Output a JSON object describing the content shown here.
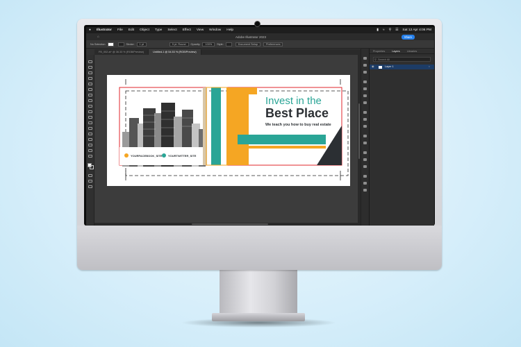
{
  "menubar": {
    "apple_icon": "apple-icon",
    "items": [
      "Illustrator",
      "File",
      "Edit",
      "Object",
      "Type",
      "Select",
      "Effect",
      "View",
      "Window",
      "Help"
    ],
    "clock": "Sat 12 Apr  4:06 PM"
  },
  "titlebar": {
    "title": "Adobe Illustrator 2023",
    "share_label": "Share"
  },
  "control_bar": {
    "selection": "No Selection",
    "stroke_label": "Stroke:",
    "stroke_value": "1 pt",
    "brush": "5 pt. Round",
    "opacity_label": "Opacity:",
    "opacity_value": "100%",
    "style_label": "Style:",
    "document_setup": "Document Setup",
    "preferences": "Preferences"
  },
  "tabs": [
    {
      "label": "FB_002.ai* @ 36.33 % (RGB/Preview)",
      "active": false
    },
    {
      "label": "Untitled-1 @ 54.53 % (RGB/Preview)",
      "active": true
    }
  ],
  "panel": {
    "tabs": [
      "Properties",
      "Layers",
      "Libraries"
    ],
    "active_tab": "Layers",
    "search_placeholder": "Search All",
    "layers": [
      "Layer 1"
    ]
  },
  "artwork": {
    "headline_line1": "Invest in the",
    "headline_line2": "Best Place",
    "subline": "We teach you how to buy real estate",
    "facebook": "YOURFACEBOOK_SITE",
    "twitter": "YOURTWITTER_SITE",
    "colors": {
      "teal": "#2aa596",
      "orange": "#f5a623",
      "dark": "#2b2f33",
      "red_bleed": "#e0262b"
    }
  }
}
